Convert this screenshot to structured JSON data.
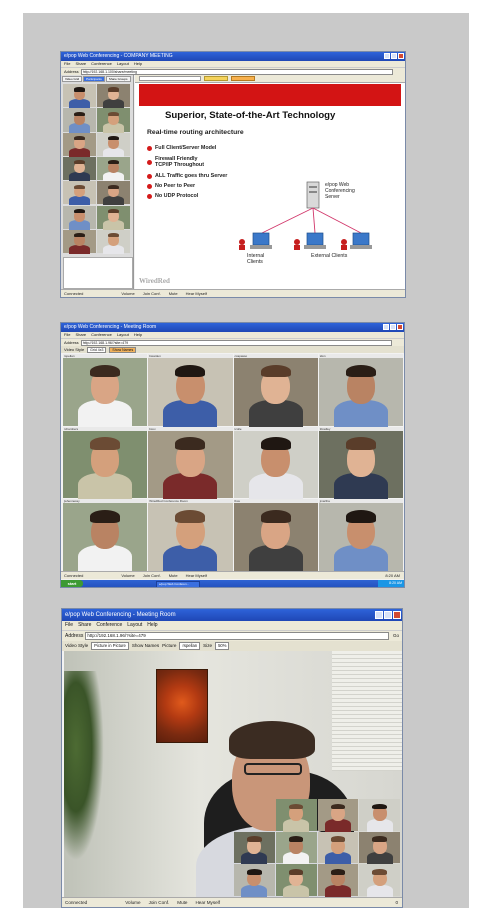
{
  "shot1": {
    "title": "e/pop Web Conferencing - COMPANY MEETING",
    "menu": [
      "File",
      "Share",
      "Conference",
      "Layout",
      "Help"
    ],
    "address_label": "Address",
    "address_value": "http://192.168.1.100/share/meeting",
    "sidebar_tabs": [
      "Video Grid",
      "Participants",
      "Share Groups"
    ],
    "slide_title": "Superior, State-of-the-Art Technology",
    "slide_subtitle": "Real-time routing architecture",
    "bullets": [
      "Full Client/Server Model",
      "Firewall Friendly\nTCP/IP Throughout",
      "ALL Traffic goes thru Server",
      "No Peer to Peer",
      "No UDP Protocol"
    ],
    "server_label": "e/pop Web\nConferencing\nServer",
    "internal_label": "Internal\nClients",
    "external_label": "External Clients",
    "footer_logo": "WiredRed",
    "status_left": "Connected",
    "status_items": [
      "Volume",
      "Join Conf.",
      "Mute",
      "Hear Myself"
    ]
  },
  "shot2": {
    "title": "e/pop Web Conferencing - Meeting Room",
    "menu": [
      "File",
      "Share",
      "Conference",
      "Layout",
      "Help"
    ],
    "address_label": "Address",
    "address_value": "http://192.168.1.96/?site=479",
    "video_style_label": "Video Style",
    "video_style_value": "Grid 4x3",
    "show_names_label": "Show Names",
    "participants": [
      "rspellan",
      "bwarden",
      "ccapasso",
      "tdon",
      "rchambers",
      "bcox",
      "tcolle",
      "tbradley",
      "jwhennessy",
      "WiredRed Conference Room",
      "lbox",
      "jmartha"
    ],
    "status_left": "Connected",
    "status_items": [
      "Volume",
      "Join Conf.",
      "Mute",
      "Hear Myself"
    ],
    "start_label": "start",
    "task_label": "e/pop Web Conferen...",
    "clock": "8:20 AM"
  },
  "shot3": {
    "title": "e/pop Web Conferencing - Meeting Room",
    "menu": [
      "File",
      "Share",
      "Conference",
      "Layout",
      "Help"
    ],
    "address_label": "Address",
    "address_value": "http://192.168.1.96/?site=479",
    "go_label": "Go",
    "video_style_label": "Video Style",
    "video_style_value": "Picture in Picture",
    "show_names_label": "Show Names",
    "picture_label": "Picture",
    "picture_value": "rspellan",
    "size_label": "Size",
    "size_value": "50%",
    "status_left": "Connected",
    "status_items": [
      "Volume",
      "Join Conf.",
      "Mute",
      "Hear Myself"
    ],
    "clock": "0 "
  }
}
